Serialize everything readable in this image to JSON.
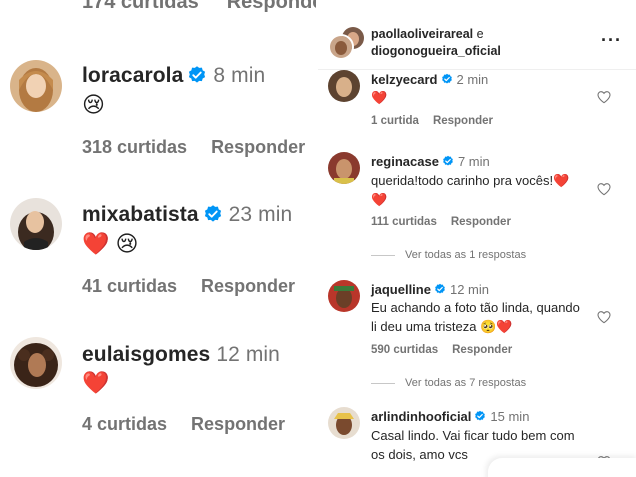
{
  "left": {
    "top_cut": {
      "likes": "174 curtidas",
      "reply": "Responder"
    },
    "comments": [
      {
        "username": "loracarola",
        "time": "8 min",
        "emoji": "😢",
        "likes": "318 curtidas",
        "reply": "Responder",
        "verified": true
      },
      {
        "username": "mixabatista",
        "time": "23 min",
        "emoji": "❤️ 😢",
        "likes": "41 curtidas",
        "reply": "Responder",
        "verified": true
      },
      {
        "username": "eulaisgomes",
        "time": "12 min",
        "emoji": "❤️",
        "likes": "4 curtidas",
        "reply": "Responder",
        "verified": false
      }
    ]
  },
  "right": {
    "header": {
      "user1": "paollaoliveirareal",
      "conj": "e",
      "user2": "diogonogueira_oficial",
      "more": "···"
    },
    "comments": [
      {
        "username": "kelzyecard",
        "time": "2 min",
        "text": "❤️",
        "likes": "1 curtida",
        "reply": "Responder",
        "verified": true
      },
      {
        "username": "reginacase",
        "time": "7 min",
        "text": "querida!todo carinho pra vocês!❤️ ❤️",
        "likes": "111 curtidas",
        "reply": "Responder",
        "verified": true,
        "view_all": "Ver todas as 1 respostas"
      },
      {
        "username": "jaquelline",
        "time": "12 min",
        "text": "Eu achando a foto tão linda, quando li deu uma tristeza 🥺❤️",
        "likes": "590 curtidas",
        "reply": "Responder",
        "verified": true,
        "view_all": "Ver todas as 7 respostas"
      },
      {
        "username": "arlindinhooficial",
        "time": "15 min",
        "text": "Casal lindo. Vai ficar tudo bem com os dois, amo vcs",
        "verified": true
      }
    ]
  },
  "colors": {
    "verified": "#0095f6",
    "heart": "#e0245e",
    "muted": "#737373"
  }
}
